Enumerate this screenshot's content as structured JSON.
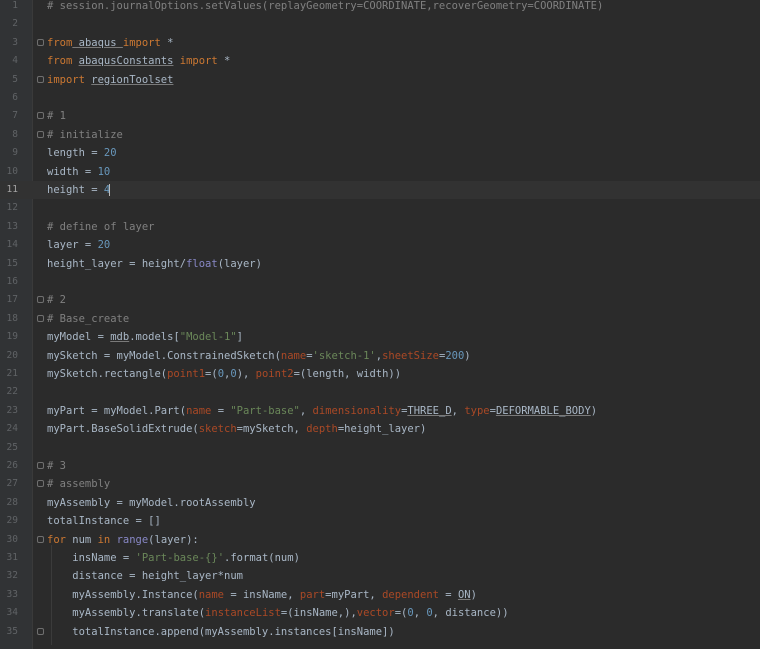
{
  "editor": {
    "current_line": 11,
    "lines": [
      {
        "n": "1",
        "fold": false,
        "tokens": [
          {
            "t": "# session.journalOptions.setValues(replayGeometry=COORDINATE,recoverGeometry=COORDINATE)",
            "c": "cm"
          }
        ]
      },
      {
        "n": "2",
        "fold": false,
        "tokens": []
      },
      {
        "n": "3",
        "fold": true,
        "tokens": [
          {
            "t": "from",
            "c": "kw"
          },
          {
            "t": " abaqus ",
            "c": "ul"
          },
          {
            "t": "import",
            "c": "kw"
          },
          {
            "t": " *"
          }
        ]
      },
      {
        "n": "4",
        "fold": false,
        "tokens": [
          {
            "t": "from",
            "c": "kw"
          },
          {
            "t": " "
          },
          {
            "t": "abaqusConstants",
            "c": "ul"
          },
          {
            "t": " "
          },
          {
            "t": "import",
            "c": "kw"
          },
          {
            "t": " *"
          }
        ]
      },
      {
        "n": "5",
        "fold": true,
        "tokens": [
          {
            "t": "import",
            "c": "kw"
          },
          {
            "t": " "
          },
          {
            "t": "regionToolset",
            "c": "ul"
          }
        ]
      },
      {
        "n": "6",
        "fold": false,
        "tokens": []
      },
      {
        "n": "7",
        "fold": true,
        "tokens": [
          {
            "t": "# 1",
            "c": "cm"
          }
        ]
      },
      {
        "n": "8",
        "fold": true,
        "tokens": [
          {
            "t": "# initialize",
            "c": "cm"
          }
        ]
      },
      {
        "n": "9",
        "fold": false,
        "tokens": [
          {
            "t": "length = "
          },
          {
            "t": "20",
            "c": "num"
          }
        ]
      },
      {
        "n": "10",
        "fold": false,
        "tokens": [
          {
            "t": "width = "
          },
          {
            "t": "10",
            "c": "num"
          }
        ]
      },
      {
        "n": "11",
        "fold": false,
        "tokens": [
          {
            "t": "height = "
          },
          {
            "t": "4",
            "c": "num"
          }
        ],
        "caret": true
      },
      {
        "n": "12",
        "fold": false,
        "tokens": []
      },
      {
        "n": "13",
        "fold": false,
        "tokens": [
          {
            "t": "# define of layer",
            "c": "cm"
          }
        ]
      },
      {
        "n": "14",
        "fold": false,
        "tokens": [
          {
            "t": "layer = "
          },
          {
            "t": "20",
            "c": "num"
          }
        ]
      },
      {
        "n": "15",
        "fold": false,
        "tokens": [
          {
            "t": "height_layer = height/"
          },
          {
            "t": "float",
            "c": "bi"
          },
          {
            "t": "(layer)"
          }
        ]
      },
      {
        "n": "16",
        "fold": false,
        "tokens": []
      },
      {
        "n": "17",
        "fold": true,
        "tokens": [
          {
            "t": "# 2",
            "c": "cm"
          }
        ]
      },
      {
        "n": "18",
        "fold": true,
        "tokens": [
          {
            "t": "# Base_create",
            "c": "cm"
          }
        ]
      },
      {
        "n": "19",
        "fold": false,
        "tokens": [
          {
            "t": "myModel = "
          },
          {
            "t": "mdb",
            "c": "ul"
          },
          {
            "t": ".models["
          },
          {
            "t": "\"Model-1\"",
            "c": "str"
          },
          {
            "t": "]"
          }
        ]
      },
      {
        "n": "20",
        "fold": false,
        "tokens": [
          {
            "t": "mySketch = myModel.ConstrainedSketch("
          },
          {
            "t": "name",
            "c": "kwarg"
          },
          {
            "t": "="
          },
          {
            "t": "'sketch-1'",
            "c": "str"
          },
          {
            "t": ","
          },
          {
            "t": "sheetSize",
            "c": "kwarg"
          },
          {
            "t": "="
          },
          {
            "t": "200",
            "c": "num"
          },
          {
            "t": ")"
          }
        ]
      },
      {
        "n": "21",
        "fold": false,
        "tokens": [
          {
            "t": "mySketch.rectangle("
          },
          {
            "t": "point1",
            "c": "kwarg"
          },
          {
            "t": "=("
          },
          {
            "t": "0",
            "c": "num"
          },
          {
            "t": ","
          },
          {
            "t": "0",
            "c": "num"
          },
          {
            "t": "), "
          },
          {
            "t": "point2",
            "c": "kwarg"
          },
          {
            "t": "=(length, width))"
          }
        ]
      },
      {
        "n": "22",
        "fold": false,
        "tokens": []
      },
      {
        "n": "23",
        "fold": false,
        "tokens": [
          {
            "t": "myPart = myModel.Part("
          },
          {
            "t": "name",
            "c": "kwarg"
          },
          {
            "t": " = "
          },
          {
            "t": "\"Part-base\"",
            "c": "str"
          },
          {
            "t": ", "
          },
          {
            "t": "dimensionality",
            "c": "kwarg"
          },
          {
            "t": "="
          },
          {
            "t": "THREE_D",
            "c": "ul"
          },
          {
            "t": ", "
          },
          {
            "t": "type",
            "c": "kwarg"
          },
          {
            "t": "="
          },
          {
            "t": "DEFORMABLE_BODY",
            "c": "ul"
          },
          {
            "t": ")"
          }
        ]
      },
      {
        "n": "24",
        "fold": false,
        "tokens": [
          {
            "t": "myPart.BaseSolidExtrude("
          },
          {
            "t": "sketch",
            "c": "kwarg"
          },
          {
            "t": "=mySketch, "
          },
          {
            "t": "depth",
            "c": "kwarg"
          },
          {
            "t": "=height_layer)"
          }
        ]
      },
      {
        "n": "25",
        "fold": false,
        "tokens": []
      },
      {
        "n": "26",
        "fold": true,
        "tokens": [
          {
            "t": "# 3",
            "c": "cm"
          }
        ]
      },
      {
        "n": "27",
        "fold": true,
        "tokens": [
          {
            "t": "# assembly",
            "c": "cm"
          }
        ]
      },
      {
        "n": "28",
        "fold": false,
        "tokens": [
          {
            "t": "myAssembly = myModel.rootAssembly"
          }
        ]
      },
      {
        "n": "29",
        "fold": false,
        "tokens": [
          {
            "t": "totalInstance = []"
          }
        ]
      },
      {
        "n": "30",
        "fold": true,
        "tokens": [
          {
            "t": "for",
            "c": "kw"
          },
          {
            "t": " num "
          },
          {
            "t": "in",
            "c": "kw"
          },
          {
            "t": " "
          },
          {
            "t": "range",
            "c": "bi"
          },
          {
            "t": "(layer):"
          }
        ]
      },
      {
        "n": "31",
        "fold": false,
        "tokens": [
          {
            "t": "    insName = "
          },
          {
            "t": "'Part-base-{}'",
            "c": "str"
          },
          {
            "t": ".format(num)"
          }
        ]
      },
      {
        "n": "32",
        "fold": false,
        "tokens": [
          {
            "t": "    distance = height_layer*num"
          }
        ]
      },
      {
        "n": "33",
        "fold": false,
        "tokens": [
          {
            "t": "    myAssembly.Instance("
          },
          {
            "t": "name",
            "c": "kwarg"
          },
          {
            "t": " = insName, "
          },
          {
            "t": "part",
            "c": "kwarg"
          },
          {
            "t": "=myPart, "
          },
          {
            "t": "dependent",
            "c": "kwarg"
          },
          {
            "t": " = "
          },
          {
            "t": "ON",
            "c": "ul"
          },
          {
            "t": ")"
          }
        ]
      },
      {
        "n": "34",
        "fold": false,
        "tokens": [
          {
            "t": "    myAssembly.translate("
          },
          {
            "t": "instanceList",
            "c": "kwarg"
          },
          {
            "t": "=(insName,),"
          },
          {
            "t": "vector",
            "c": "kwarg"
          },
          {
            "t": "=("
          },
          {
            "t": "0",
            "c": "num"
          },
          {
            "t": ", "
          },
          {
            "t": "0",
            "c": "num"
          },
          {
            "t": ", distance))"
          }
        ]
      },
      {
        "n": "35",
        "fold": true,
        "tokens": [
          {
            "t": "    totalInstance.append(myAssembly.instances[insName])"
          }
        ]
      }
    ]
  }
}
